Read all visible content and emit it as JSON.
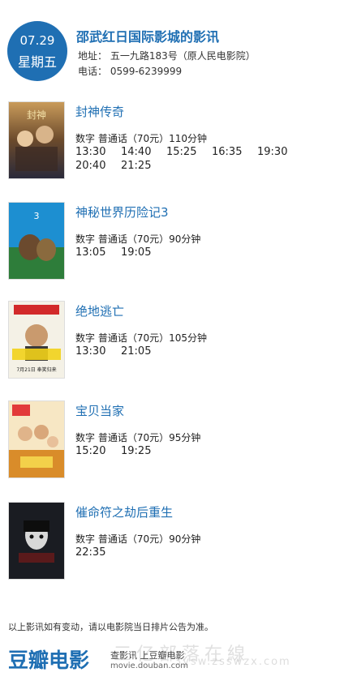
{
  "header": {
    "date": "07.29",
    "weekday": "星期五",
    "cinema_name": "邵武红日国际影城的影讯",
    "address": "地址： 五一九路183号（原人民电影院）",
    "phone": "电话： 0599-6239999"
  },
  "movies": [
    {
      "title": "封神传奇",
      "info": "数字  普通话（70元）110分钟",
      "times": [
        "13:30",
        "14:40",
        "15:25",
        "16:35",
        "19:30",
        "20:40",
        "21:25"
      ]
    },
    {
      "title": "神秘世界历险记3",
      "info": "数字  普通话（70元）90分钟",
      "times": [
        "13:05",
        "19:05"
      ]
    },
    {
      "title": "绝地逃亡",
      "info": "数字  普通话（70元）105分钟",
      "times": [
        "13:30",
        "21:05"
      ]
    },
    {
      "title": "宝贝当家",
      "info": "数字  普通话（70元）95分钟",
      "times": [
        "15:20",
        "19:25"
      ]
    },
    {
      "title": "催命符之劫后重生",
      "info": "数字  普通话（70元）90分钟",
      "times": [
        "22:35"
      ]
    }
  ],
  "poster_texts": {
    "jedi": "7月21日 奉笑归来"
  },
  "note": "以上影讯如有变动，请以电影院当日排片公告为准。",
  "footer": {
    "logo": "豆瓣电影",
    "text": "查影讯  上豆瓣电影",
    "url": "movie.douban.com",
    "watermark": "三亿部落在線",
    "watermark_url": "3ysw.zsswzx.com"
  },
  "colors": {
    "accent": "#1f6fb3"
  }
}
